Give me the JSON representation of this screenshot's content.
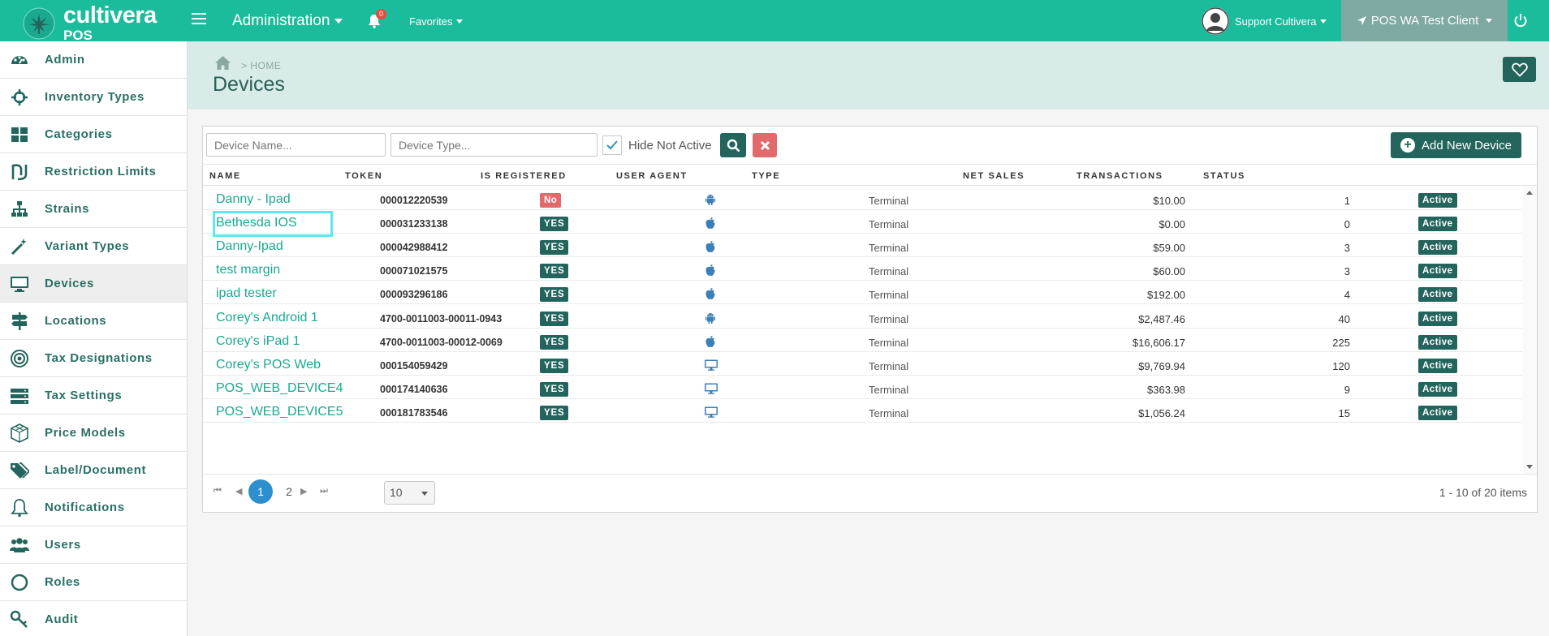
{
  "app": {
    "logo_name": "cultivera",
    "logo_sub": "POS",
    "admin_menu": "Administration",
    "notification_count": "0",
    "favorites": "Favorites",
    "user_name": "Support Cultivera",
    "client_name": "POS WA Test Client"
  },
  "sidebar": {
    "items": [
      {
        "label": "Admin",
        "icon": "dashboard-icon"
      },
      {
        "label": "Inventory Types",
        "icon": "crosshair-icon"
      },
      {
        "label": "Categories",
        "icon": "grid-icon"
      },
      {
        "label": "Restriction Limits",
        "icon": "restriction-icon"
      },
      {
        "label": "Strains",
        "icon": "sitemap-icon"
      },
      {
        "label": "Variant Types",
        "icon": "magic-wand-icon"
      },
      {
        "label": "Devices",
        "icon": "monitor-icon"
      },
      {
        "label": "Locations",
        "icon": "signpost-icon"
      },
      {
        "label": "Tax Designations",
        "icon": "target-icon"
      },
      {
        "label": "Tax Settings",
        "icon": "server-icon"
      },
      {
        "label": "Price Models",
        "icon": "cube-icon"
      },
      {
        "label": "Label/Document",
        "icon": "tags-icon"
      },
      {
        "label": "Notifications",
        "icon": "bell-icon"
      },
      {
        "label": "Users",
        "icon": "users-icon"
      },
      {
        "label": "Roles",
        "icon": "circle-icon"
      },
      {
        "label": "Audit",
        "icon": "key-icon"
      }
    ],
    "active": "Devices"
  },
  "page": {
    "breadcrumb": "> HOME",
    "title": "Devices"
  },
  "toolbar": {
    "device_name_placeholder": "Device Name...",
    "device_type_placeholder": "Device Type...",
    "hide_not_active_label": "Hide Not Active",
    "hide_not_active_checked": true,
    "add_button": "Add New Device"
  },
  "table": {
    "columns": [
      "NAME",
      "TOKEN",
      "IS REGISTERED",
      "USER AGENT",
      "TYPE",
      "NET SALES",
      "TRANSACTIONS",
      "STATUS"
    ],
    "rows": [
      {
        "name": "Danny - Ipad",
        "token": "000012220539",
        "registered": "No",
        "agent": "android-icon",
        "type": "Terminal",
        "net_sales": "$10.00",
        "transactions": "1",
        "status": "Active"
      },
      {
        "name": "Bethesda IOS",
        "token": "000031233138",
        "registered": "YES",
        "agent": "apple-icon",
        "type": "Terminal",
        "net_sales": "$0.00",
        "transactions": "0",
        "status": "Active"
      },
      {
        "name": "Danny-Ipad",
        "token": "000042988412",
        "registered": "YES",
        "agent": "apple-icon",
        "type": "Terminal",
        "net_sales": "$59.00",
        "transactions": "3",
        "status": "Active"
      },
      {
        "name": "test margin",
        "token": "000071021575",
        "registered": "YES",
        "agent": "apple-icon",
        "type": "Terminal",
        "net_sales": "$60.00",
        "transactions": "3",
        "status": "Active"
      },
      {
        "name": "ipad tester",
        "token": "000093296186",
        "registered": "YES",
        "agent": "apple-icon",
        "type": "Terminal",
        "net_sales": "$192.00",
        "transactions": "4",
        "status": "Active"
      },
      {
        "name": "Corey's Android 1",
        "token": "4700-0011003-00011-0943",
        "registered": "YES",
        "agent": "android-icon",
        "type": "Terminal",
        "net_sales": "$2,487.46",
        "transactions": "40",
        "status": "Active"
      },
      {
        "name": "Corey's iPad 1",
        "token": "4700-0011003-00012-0069",
        "registered": "YES",
        "agent": "apple-icon",
        "type": "Terminal",
        "net_sales": "$16,606.17",
        "transactions": "225",
        "status": "Active"
      },
      {
        "name": "Corey's POS Web",
        "token": "000154059429",
        "registered": "YES",
        "agent": "desktop-icon",
        "type": "Terminal",
        "net_sales": "$9,769.94",
        "transactions": "120",
        "status": "Active"
      },
      {
        "name": "POS_WEB_DEVICE4",
        "token": "000174140636",
        "registered": "YES",
        "agent": "desktop-icon",
        "type": "Terminal",
        "net_sales": "$363.98",
        "transactions": "9",
        "status": "Active"
      },
      {
        "name": "POS_WEB_DEVICE5",
        "token": "000181783546",
        "registered": "YES",
        "agent": "desktop-icon",
        "type": "Terminal",
        "net_sales": "$1,056.24",
        "transactions": "15",
        "status": "Active"
      }
    ],
    "highlighted_row": 1
  },
  "pager": {
    "pages": [
      "1",
      "2"
    ],
    "current_page": "1",
    "page_size": "10",
    "info": "1 - 10 of 20 items"
  },
  "colors": {
    "topbar": "#1abc9c",
    "accent_dark": "#23655c",
    "link": "#1aa98f",
    "danger": "#e26a6a",
    "highlight": "#66e3f0"
  }
}
